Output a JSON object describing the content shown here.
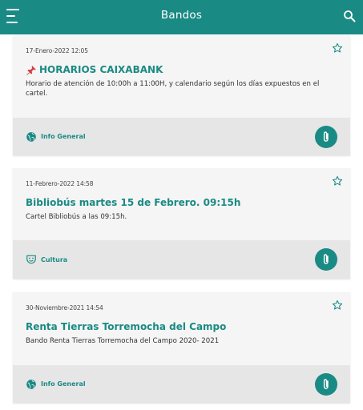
{
  "appbar": {
    "title": "Bandos",
    "menu_icon": "menu-icon",
    "search_icon": "search-icon",
    "color": "#1a8a84"
  },
  "bandos": [
    {
      "date": "17-Enero-2022 12:05",
      "pinned": true,
      "title": "HORARIOS CAIXABANK",
      "description": "Horario de atención de 10:00h a 11:00H, y calendario según los días expuestos en el cartel.",
      "category": "Info General",
      "category_icon": "globe-icon"
    },
    {
      "date": "11-Febrero-2022 14:58",
      "pinned": false,
      "title": "Bibliobús martes 15 de Febrero.  09:15h",
      "description": "Cartel Bibliobús a las 09:15h.",
      "category": "Cultura",
      "category_icon": "theater-mask-icon"
    },
    {
      "date": "30-Noviembre-2021 14:54",
      "pinned": false,
      "title": "Renta Tierras Torremocha del Campo",
      "description": "Bando Renta Tierras Torremocha del Campo 2020- 2021",
      "category": "Info General",
      "category_icon": "globe-icon"
    }
  ]
}
